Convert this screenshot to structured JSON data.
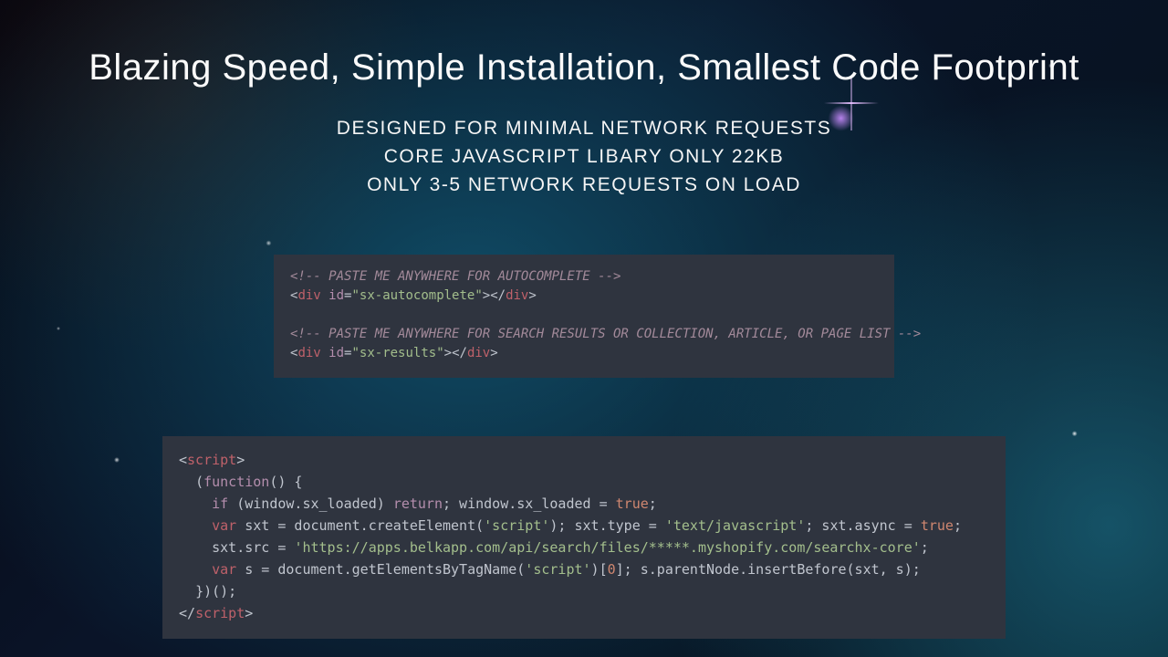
{
  "title": "Blazing Speed, Simple Installation, Smallest Code Footprint",
  "subtitles": [
    "DESIGNED FOR MINIMAL NETWORK REQUESTS",
    "CORE JAVASCRIPT LIBARY ONLY 22KB",
    "ONLY 3-5 NETWORK REQUESTS ON LOAD"
  ],
  "code1": {
    "comment1": "<!-- PASTE ME ANYWHERE FOR AUTOCOMPLETE -->",
    "div1_id": "sx-autocomplete",
    "comment2": "<!-- PASTE ME ANYWHERE FOR SEARCH RESULTS OR COLLECTION, ARTICLE, OR PAGE LIST -->",
    "div2_id": "sx-results"
  },
  "code2": {
    "line1_open": "<script>",
    "line2_func": "(function() {",
    "line3": {
      "if": "if",
      "cond": "(window.sx_loaded)",
      "ret": "return",
      "rest": "; window.sx_loaded = ",
      "true": "true",
      "end": ";"
    },
    "line4": {
      "var": "var",
      "decl": " sxt = document.createElement(",
      "str1": "'script'",
      "mid": "); sxt.type = ",
      "str2": "'text/javascript'",
      "mid2": "; sxt.async = ",
      "true": "true",
      "end": ";"
    },
    "line5_src": "'https://apps.belkapp.com/api/search/files/*****.myshopify.com/searchx-core'",
    "line5_prefix": "sxt.src = ",
    "line5_end": ";",
    "line6": {
      "var": "var",
      "decl": " s = document.getElementsByTagName(",
      "str": "'script'",
      "mid": ")[",
      "num": "0",
      "rest": "]; s.parentNode.insertBefore(sxt, s);"
    },
    "line7_close": "})();",
    "line8_close": "</script>"
  }
}
